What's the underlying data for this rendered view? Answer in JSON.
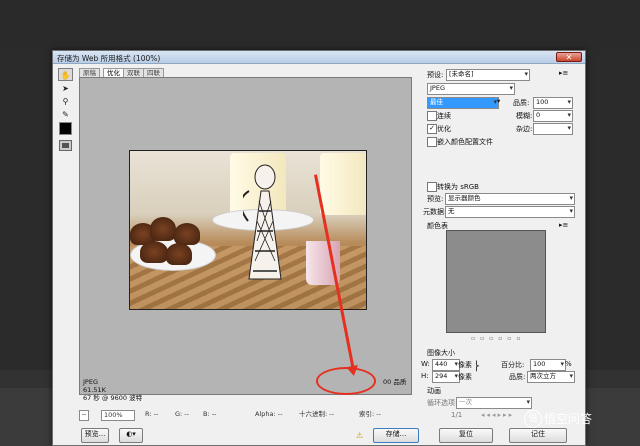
{
  "dialog": {
    "title": "存储为 Web 所用格式 (100%)",
    "close": "✕"
  },
  "tools": [
    "hand-icon",
    "slice-select-icon",
    "zoom-icon",
    "eyedropper-icon"
  ],
  "tabs": [
    "原稿",
    "优化",
    "双联",
    "四联"
  ],
  "preview_info": {
    "format": "JPEG",
    "size": "61.51K",
    "time": "67 秒 @ 9600 波特",
    "quality": "00 品质"
  },
  "statusbar": {
    "zoom": "100%",
    "r": "R: --",
    "g": "G: --",
    "b": "B: --",
    "alpha": "Alpha: --",
    "hex": "十六进制: --",
    "index": "索引: --"
  },
  "buttons": {
    "preview": "预览...",
    "save": "存储...",
    "reset": "复位",
    "done": "记住"
  },
  "settings": {
    "preset_label": "预设:",
    "preset_value": "[未命名]",
    "format": "JPEG",
    "quality_preset": "最佳",
    "quality_label": "品质:",
    "quality_value": "100",
    "progressive": "连续",
    "blur_label": "模糊:",
    "blur_value": "0",
    "optimized": "优化",
    "matte_label": "杂边:",
    "embed_profile": "嵌入颜色配置文件",
    "convert_srgb": "转换为 sRGB",
    "preview_label": "预览:",
    "preview_value": "显示器颜色",
    "metadata_label": "元数据:",
    "metadata_value": "无",
    "color_table": "颜色表"
  },
  "image_size": {
    "title": "图像大小",
    "w_label": "W:",
    "w_value": "440",
    "h_label": "H:",
    "h_value": "294",
    "unit": "像素",
    "percent_label": "百分比:",
    "percent_value": "100",
    "percent_unit": "%",
    "quality_label": "品质:",
    "quality_value": "两次立方"
  },
  "animation": {
    "title": "动画",
    "loop_label": "循环选项:",
    "loop_value": "一次",
    "frame": "1/1"
  },
  "watermark": "悟空问答",
  "colors": {
    "accent": "#3399ff",
    "annotation": "#e53020"
  }
}
